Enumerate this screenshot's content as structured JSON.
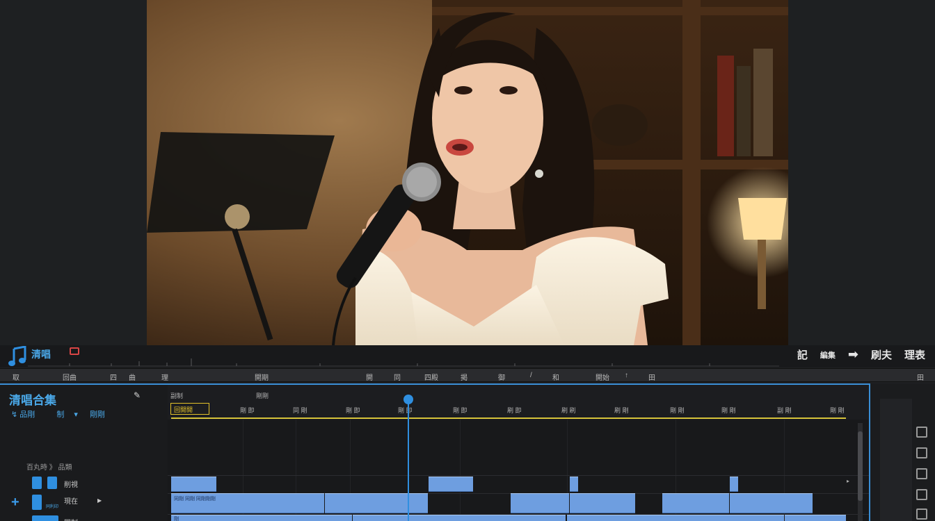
{
  "transport": {
    "title": "清唱",
    "right_labels": [
      "記",
      "編集",
      "刷夫",
      "理表"
    ]
  },
  "toolbar": {
    "items": [
      "取",
      "回曲",
      "四",
      "曲",
      "理",
      "開期",
      "開",
      "同",
      "四殿",
      "掲",
      "御",
      "/",
      "和",
      "開始",
      "↑",
      "田",
      "田"
    ]
  },
  "left_panel": {
    "project_title": "清唱合集",
    "sub_items": [
      "品剛",
      "制",
      "剛剛"
    ],
    "track_header": "百丸時 》 品類",
    "tracks": [
      {
        "name": "削視"
      },
      {
        "name": "現在",
        "sub": "同利印"
      },
      {
        "name": "同制"
      }
    ]
  },
  "timeline": {
    "top_labels": [
      "副制",
      "剛剛"
    ],
    "in_point_label": "回開開",
    "ruler_labels": [
      "剛 即",
      "同 剛",
      "剛 即",
      "剛 即",
      "剛 即",
      "刷 即",
      "刷 刷",
      "刷 剛",
      "剛 剛",
      "剛 剛",
      "副 剛",
      "剛 剛"
    ],
    "clip_labels": [
      "同剛 同剛 同剛剛剛",
      "剛"
    ]
  },
  "colors": {
    "accent": "#2f8fe0",
    "clip": "#6e9ee0",
    "work_area": "#d8c43a",
    "record": "#d94545"
  },
  "icons": [
    "music-note-icon",
    "record-icon",
    "arrow-right-icon",
    "pin-icon",
    "plus-icon",
    "playhead-icon",
    "panel-icon"
  ]
}
